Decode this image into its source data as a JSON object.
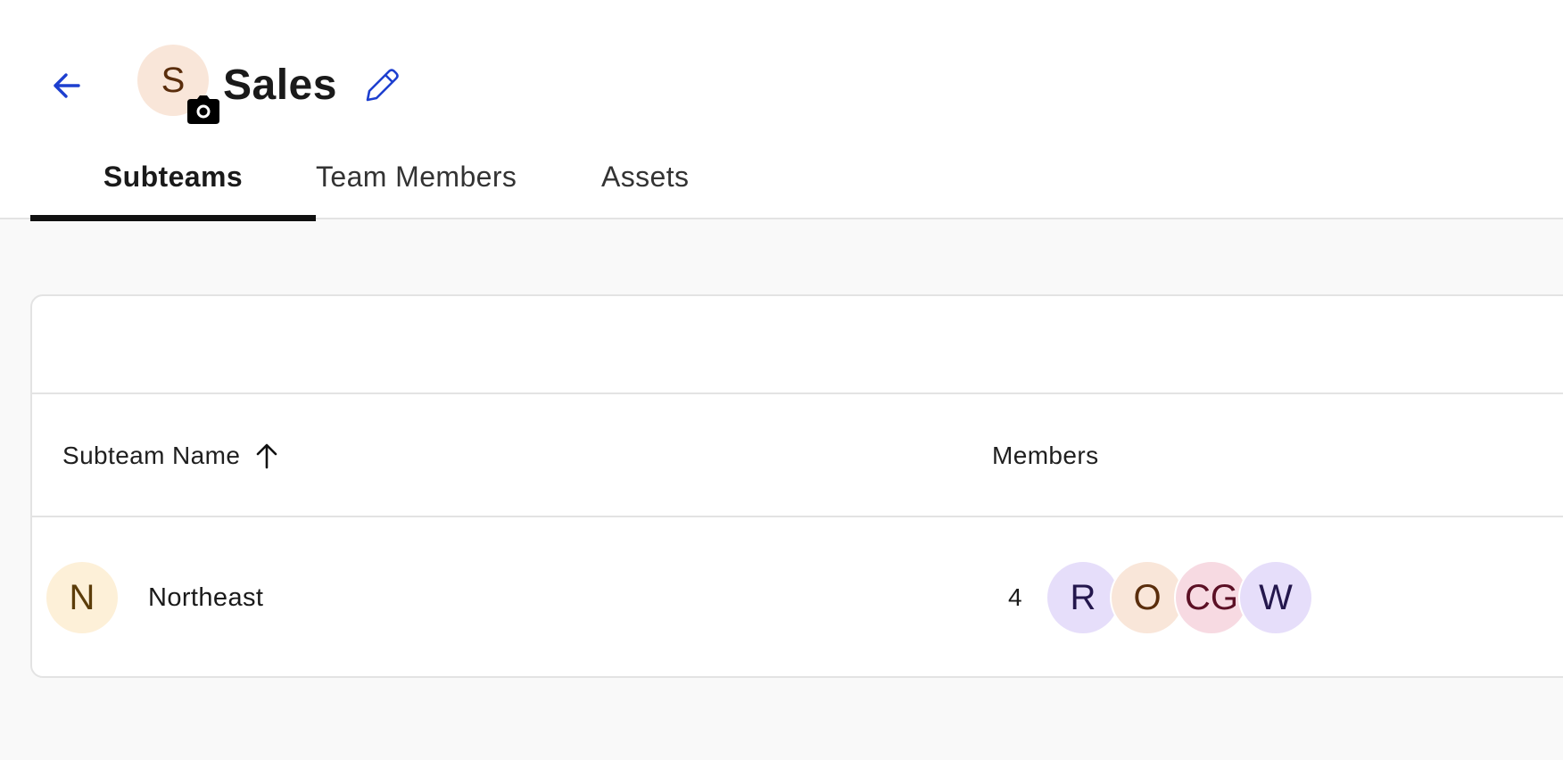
{
  "header": {
    "team_initial": "S",
    "team_name": "Sales",
    "team_avatar_bg": "#f9e6d9",
    "team_avatar_fg": "#5a2d0c",
    "icons": {
      "back": "arrow-left-icon",
      "camera": "camera-icon",
      "edit": "pencil-icon"
    },
    "accent_color": "#1d3fcf"
  },
  "tabs": [
    {
      "label": "Subteams",
      "active": true
    },
    {
      "label": "Team Members",
      "active": false
    },
    {
      "label": "Assets",
      "active": false
    }
  ],
  "table": {
    "columns": {
      "name": "Subteam Name",
      "members": "Members"
    },
    "sort": "ascending",
    "rows": [
      {
        "initial": "N",
        "avatar_bg": "#fdf0d8",
        "avatar_fg": "#5c3d0a",
        "name": "Northeast",
        "member_count": "4",
        "members": [
          {
            "initials": "R",
            "bg": "#e6defa",
            "fg": "#24174d"
          },
          {
            "initials": "O",
            "bg": "#f9e6d9",
            "fg": "#5a2d0c"
          },
          {
            "initials": "CG",
            "bg": "#f7dae2",
            "fg": "#5c1025"
          },
          {
            "initials": "W",
            "bg": "#e6defa",
            "fg": "#24174d"
          }
        ]
      }
    ]
  }
}
